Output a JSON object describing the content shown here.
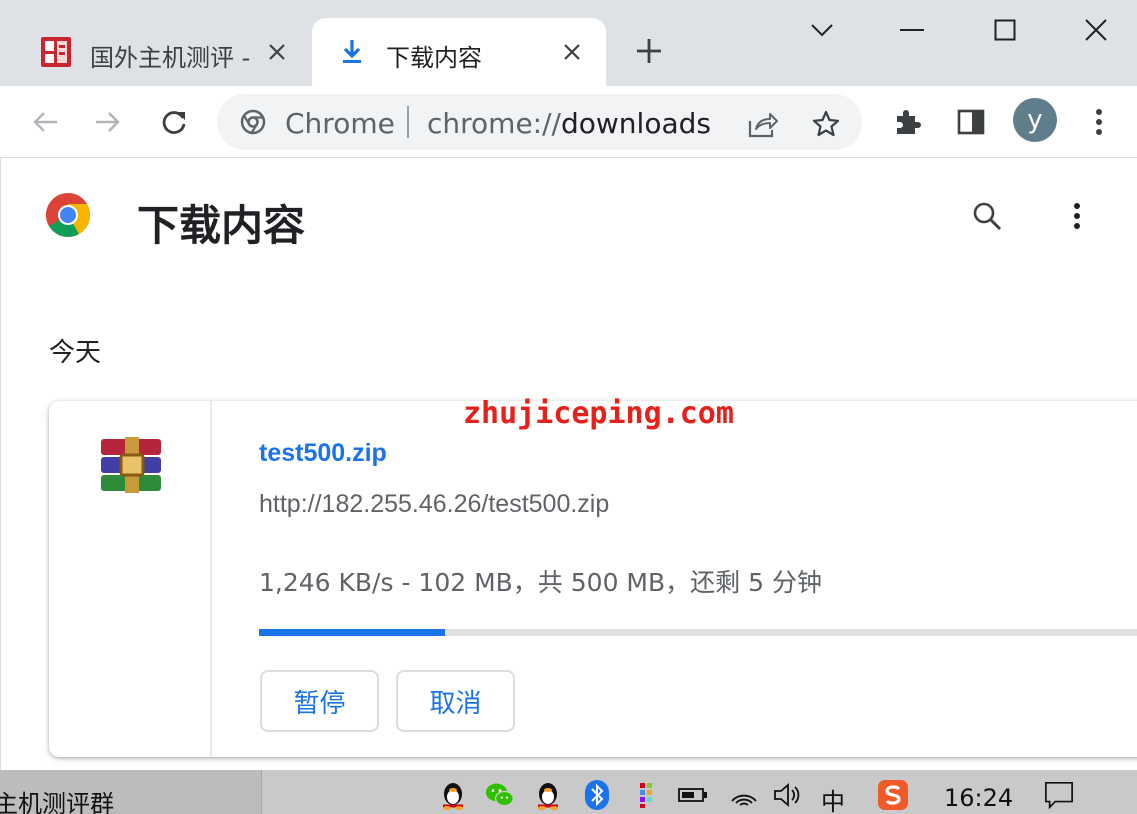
{
  "browser": {
    "tabs": [
      {
        "title": "国外主机测评 -",
        "icon": "site-favicon",
        "active": false
      },
      {
        "title": "下载内容",
        "icon": "download-icon",
        "active": true
      }
    ],
    "omnibox": {
      "chip_label": "Chrome",
      "url_scheme": "chrome://",
      "url_host": "downloads"
    },
    "profile_initial": "y"
  },
  "page": {
    "title": "下载内容",
    "date_header": "今天",
    "watermark": "zhujiceping.com",
    "download": {
      "file_name": "test500.zip",
      "url": "http://182.255.46.26/test500.zip",
      "status": "1,246 KB/s - 102 MB，共 500 MB，还剩 5 分钟",
      "progress_fraction": 0.204,
      "pause_label": "暂停",
      "cancel_label": "取消"
    }
  },
  "taskbar": {
    "window_label": "主机测评群",
    "ime_label": "中",
    "time": "16:24"
  },
  "colors": {
    "accent": "#1a73e8",
    "tabstrip": "#dee1e6",
    "watermark": "#e8201a"
  }
}
